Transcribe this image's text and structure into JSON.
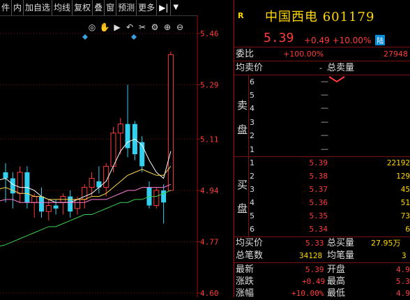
{
  "toolbar": {
    "items": [
      "件",
      "内",
      "加自选",
      "均线",
      "复权",
      "叠",
      "窗",
      "预测",
      "更多"
    ],
    "arrow": "▶|",
    "drop": "▼"
  },
  "icons": [
    "eye-icon",
    "hand-icon",
    "play-icon",
    "undo-icon",
    "cut-icon",
    "settings-icon",
    "zoom-in-icon",
    "zoom-out-icon"
  ],
  "icon_glyphs": [
    "◎",
    "✋",
    "▶",
    "↶",
    "✂",
    "⚙",
    "⊕",
    "⊖"
  ],
  "chart_data": {
    "type": "candlestick",
    "ylabels": [
      "5.46",
      "5.29",
      "5.11",
      "4.94",
      "4.77",
      "4.60"
    ],
    "ylim": [
      4.6,
      5.46
    ],
    "up_color": "#ff3b3b",
    "down_color": "#34d0f0",
    "candles": [
      {
        "o": 5.0,
        "h": 5.03,
        "l": 4.9,
        "c": 4.98
      },
      {
        "o": 4.98,
        "h": 5.0,
        "l": 4.88,
        "c": 4.93
      },
      {
        "o": 4.93,
        "h": 5.02,
        "l": 4.9,
        "c": 5.0
      },
      {
        "o": 5.0,
        "h": 5.02,
        "l": 4.88,
        "c": 4.9
      },
      {
        "o": 4.9,
        "h": 4.93,
        "l": 4.85,
        "c": 4.92
      },
      {
        "o": 4.92,
        "h": 4.95,
        "l": 4.85,
        "c": 4.87
      },
      {
        "o": 4.87,
        "h": 4.91,
        "l": 4.84,
        "c": 4.89
      },
      {
        "o": 4.89,
        "h": 4.91,
        "l": 4.86,
        "c": 4.88
      },
      {
        "o": 4.9,
        "h": 4.93,
        "l": 4.86,
        "c": 4.92
      },
      {
        "o": 4.92,
        "h": 4.94,
        "l": 4.85,
        "c": 4.87
      },
      {
        "o": 4.88,
        "h": 4.92,
        "l": 4.86,
        "c": 4.91
      },
      {
        "o": 4.91,
        "h": 4.96,
        "l": 4.88,
        "c": 4.95
      },
      {
        "o": 4.95,
        "h": 5.0,
        "l": 4.92,
        "c": 4.98
      },
      {
        "o": 4.97,
        "h": 5.02,
        "l": 4.93,
        "c": 4.95
      },
      {
        "o": 4.95,
        "h": 5.03,
        "l": 4.92,
        "c": 5.02
      },
      {
        "o": 5.02,
        "h": 5.15,
        "l": 5.0,
        "c": 5.13
      },
      {
        "o": 5.13,
        "h": 5.18,
        "l": 5.06,
        "c": 5.16
      },
      {
        "o": 5.16,
        "h": 5.29,
        "l": 5.05,
        "c": 5.08
      },
      {
        "o": 5.16,
        "h": 5.17,
        "l": 5.04,
        "c": 5.06
      },
      {
        "o": 5.1,
        "h": 5.12,
        "l": 5.0,
        "c": 5.02
      },
      {
        "o": 4.95,
        "h": 4.97,
        "l": 4.88,
        "c": 4.89
      },
      {
        "o": 4.89,
        "h": 4.95,
        "l": 4.88,
        "c": 4.94
      },
      {
        "o": 4.94,
        "h": 4.96,
        "l": 4.83,
        "c": 4.9
      },
      {
        "o": 4.94,
        "h": 5.4,
        "l": 4.94,
        "c": 5.39
      }
    ],
    "ma_lines": [
      {
        "color": "#ffffff",
        "values": [
          4.98,
          4.96,
          4.95,
          4.95,
          4.94,
          4.92,
          4.91,
          4.9,
          4.9,
          4.9,
          4.91,
          4.92,
          4.93,
          4.95,
          4.97,
          5.02,
          5.07,
          5.1,
          5.11,
          5.09,
          5.04,
          5.0,
          4.98,
          5.07
        ]
      },
      {
        "color": "#ffd54f",
        "values": [
          4.95,
          4.94,
          4.93,
          4.93,
          4.92,
          4.92,
          4.91,
          4.91,
          4.91,
          4.91,
          4.91,
          4.91,
          4.92,
          4.92,
          4.93,
          4.95,
          4.97,
          4.99,
          5.0,
          5.01,
          5.0,
          4.99,
          4.99,
          5.02
        ]
      },
      {
        "color": "#ff7bd8",
        "values": [
          4.91,
          4.91,
          4.9,
          4.9,
          4.9,
          4.9,
          4.9,
          4.9,
          4.9,
          4.9,
          4.9,
          4.9,
          4.91,
          4.91,
          4.91,
          4.92,
          4.93,
          4.94,
          4.94,
          4.95,
          4.95,
          4.95,
          4.95,
          4.96
        ]
      },
      {
        "color": "#36d24c",
        "values": [
          4.76,
          4.77,
          4.78,
          4.79,
          4.8,
          4.81,
          4.82,
          4.82,
          4.83,
          4.84,
          4.85,
          4.86,
          4.86,
          4.87,
          4.88,
          4.89,
          4.9,
          4.9,
          4.91,
          4.91,
          4.92,
          4.92,
          4.93,
          4.94
        ]
      }
    ]
  },
  "quote": {
    "badge": "R",
    "title": "中国西电 601179",
    "price": "5.39",
    "change": "+0.49",
    "change_pct": "+10.00%",
    "tag": "陆",
    "weibi_label": "委比",
    "weibi_val": "+100.00%",
    "weicha_val": "27948",
    "jmj_label": "均卖价",
    "zmll_label": "总卖量",
    "zmll_val": "-",
    "sell_side": "卖盘",
    "buy_side": "买盘",
    "sell": [
      {
        "idx": "6",
        "price": "",
        "vol": "—"
      },
      {
        "idx": "5",
        "price": "",
        "vol": "—"
      },
      {
        "idx": "4",
        "price": "",
        "vol": "—"
      },
      {
        "idx": "3",
        "price": "",
        "vol": "—"
      },
      {
        "idx": "2",
        "price": "",
        "vol": "—"
      },
      {
        "idx": "1",
        "price": "",
        "vol": "—"
      }
    ],
    "buy": [
      {
        "idx": "1",
        "price": "5.39",
        "vol": "22192"
      },
      {
        "idx": "2",
        "price": "5.38",
        "vol": "129"
      },
      {
        "idx": "3",
        "price": "5.37",
        "vol": "45"
      },
      {
        "idx": "4",
        "price": "5.36",
        "vol": "51"
      },
      {
        "idx": "5",
        "price": "5.35",
        "vol": "73"
      },
      {
        "idx": "6",
        "price": "5.34",
        "vol": "6"
      }
    ],
    "jmj2_label": "均买价",
    "jmj2_val": "5.33",
    "zml2_label": "总买量",
    "zml2_val": "27.95万",
    "zbs_label": "总笔数",
    "zbs_val": "34128",
    "jbl_label": "均笔量",
    "jbl_val": "3",
    "zx_label": "最新",
    "zx_val": "5.39",
    "kp_label": "开盘",
    "kp_val": "4.9",
    "zd_label": "涨跌",
    "zd_val": "+0.49",
    "zg_label": "最高",
    "zg_val": "5.3",
    "zf_label": "涨幅",
    "zf_val": "+10.00%",
    "zdi_label": "最低",
    "zdi_val": "4.9"
  }
}
